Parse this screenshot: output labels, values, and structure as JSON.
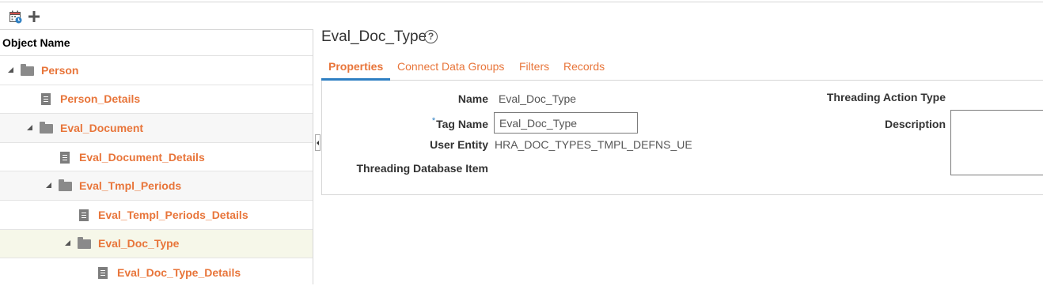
{
  "toolbar": {
    "calendar_icon": "calendar-icon",
    "add_icon": "plus-icon"
  },
  "tree": {
    "header": "Object Name",
    "rows": [
      {
        "label": "Person",
        "type": "folder",
        "expanded": true
      },
      {
        "label": "Person_Details",
        "type": "document"
      },
      {
        "label": "Eval_Document",
        "type": "folder",
        "expanded": true
      },
      {
        "label": "Eval_Document_Details",
        "type": "document"
      },
      {
        "label": "Eval_Tmpl_Periods",
        "type": "folder",
        "expanded": true
      },
      {
        "label": "Eval_Templ_Periods_Details",
        "type": "document"
      },
      {
        "label": "Eval_Doc_Type",
        "type": "folder",
        "expanded": true,
        "selected": true
      },
      {
        "label": "Eval_Doc_Type_Details",
        "type": "document"
      }
    ]
  },
  "detail": {
    "title": "Eval_Doc_Type",
    "help_icon": "help-circle-icon",
    "tabs": [
      {
        "label": "Properties",
        "active": true
      },
      {
        "label": "Connect Data Groups"
      },
      {
        "label": "Filters"
      },
      {
        "label": "Records"
      }
    ],
    "fields": {
      "name_label": "Name",
      "name_value": "Eval_Doc_Type",
      "tag_required_marker": "*",
      "tag_name_label": "Tag Name",
      "tag_name_value": "Eval_Doc_Type",
      "user_entity_label": "User Entity",
      "user_entity_value": "HRA_DOC_TYPES_TMPL_DEFNS_UE",
      "threading_db_item_label": "Threading Database Item",
      "threading_action_type_label": "Threading Action Type",
      "description_label": "Description",
      "description_value": ""
    }
  },
  "colors": {
    "link": "#e8753a",
    "active_tab_underline": "#2e7fc2",
    "selected_row": "#f6f7e9",
    "border": "#d6d6d6"
  }
}
